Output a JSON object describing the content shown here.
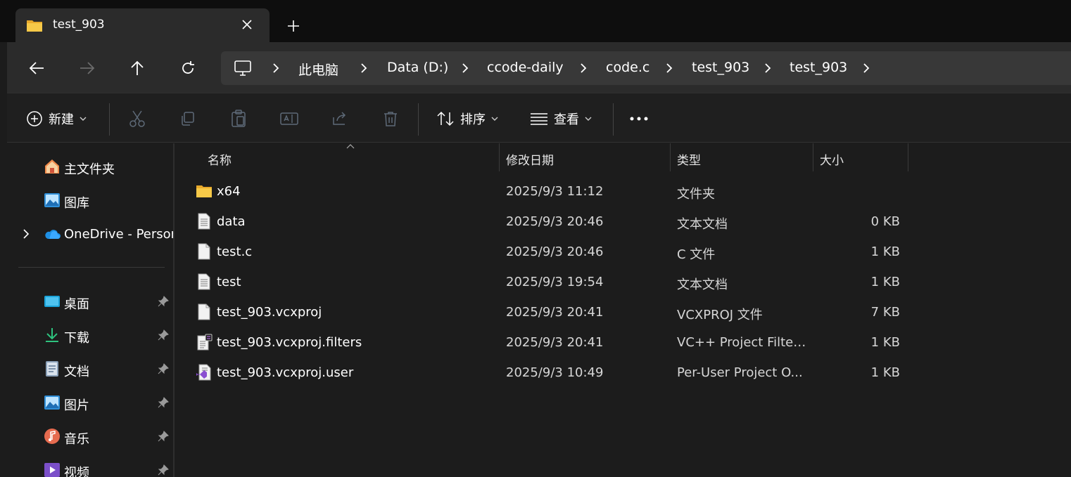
{
  "tab": {
    "title": "test_903",
    "new_tab_label": "+"
  },
  "address": {
    "crumbs": [
      "此电脑",
      "Data (D:)",
      "ccode-daily",
      "code.c",
      "test_903",
      "test_903"
    ]
  },
  "toolbar": {
    "new_label": "新建",
    "sort_label": "排序",
    "view_label": "查看",
    "more_label": "•••"
  },
  "sidebar": {
    "items": [
      {
        "label": "主文件夹",
        "icon": "home-icon"
      },
      {
        "label": "图库",
        "icon": "gallery-icon"
      },
      {
        "label": "OneDrive - Personal",
        "icon": "onedrive-icon"
      },
      {
        "label": "桌面",
        "icon": "desktop-icon",
        "pinned": true
      },
      {
        "label": "下载",
        "icon": "download-icon",
        "pinned": true
      },
      {
        "label": "文档",
        "icon": "documents-icon",
        "pinned": true
      },
      {
        "label": "图片",
        "icon": "pictures-icon",
        "pinned": true
      },
      {
        "label": "音乐",
        "icon": "music-icon",
        "pinned": true
      },
      {
        "label": "视频",
        "icon": "videos-icon",
        "pinned": true
      }
    ]
  },
  "columns": {
    "name": "名称",
    "date": "修改日期",
    "type": "类型",
    "size": "大小"
  },
  "files": [
    {
      "name": "x64",
      "date": "2025/9/3 11:12",
      "type": "文件夹",
      "size": "",
      "icon": "folder-icon"
    },
    {
      "name": "data",
      "date": "2025/9/3 20:46",
      "type": "文本文档",
      "size": "0 KB",
      "icon": "text-file-icon"
    },
    {
      "name": "test.c",
      "date": "2025/9/3 20:46",
      "type": "C 文件",
      "size": "1 KB",
      "icon": "blank-file-icon"
    },
    {
      "name": "test",
      "date": "2025/9/3 19:54",
      "type": "文本文档",
      "size": "1 KB",
      "icon": "text-file-icon"
    },
    {
      "name": "test_903.vcxproj",
      "date": "2025/9/3 20:41",
      "type": "VCXPROJ 文件",
      "size": "7 KB",
      "icon": "blank-file-icon"
    },
    {
      "name": "test_903.vcxproj.filters",
      "date": "2025/9/3 20:41",
      "type": "VC++ Project Filter...",
      "size": "1 KB",
      "icon": "filters-file-icon"
    },
    {
      "name": "test_903.vcxproj.user",
      "date": "2025/9/3 10:49",
      "type": "Per-User Project O...",
      "size": "1 KB",
      "icon": "vs-user-file-icon"
    }
  ],
  "colors": {
    "accent": "#60cdff",
    "folder": "#f4c542",
    "background": "#1c1c1c",
    "toolbar": "#2b2b2b"
  }
}
